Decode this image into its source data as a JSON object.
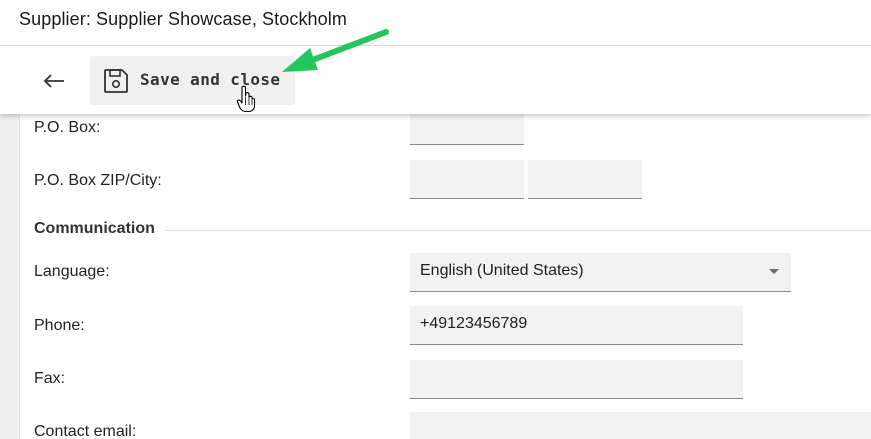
{
  "header": {
    "title": "Supplier: Supplier Showcase, Stockholm"
  },
  "toolbar": {
    "back_icon": "arrow-left-icon",
    "save_icon": "floppy-disk-icon",
    "save_label": "Save and close"
  },
  "form": {
    "po_box": {
      "label": "P.O. Box:",
      "value": ""
    },
    "po_box_zip_city": {
      "label": "P.O. Box ZIP/City:",
      "zip": "",
      "city": ""
    },
    "communication": {
      "title": "Communication",
      "language": {
        "label": "Language:",
        "value": "English (United States)"
      },
      "phone": {
        "label": "Phone:",
        "value": "+49123456789"
      },
      "fax": {
        "label": "Fax:",
        "value": ""
      },
      "contact_email": {
        "label": "Contact email:",
        "value": ""
      }
    }
  },
  "colors": {
    "field_bg": "#f2f2f2",
    "button_bg": "#f0f0f0",
    "annotation_arrow": "#22c55e"
  }
}
